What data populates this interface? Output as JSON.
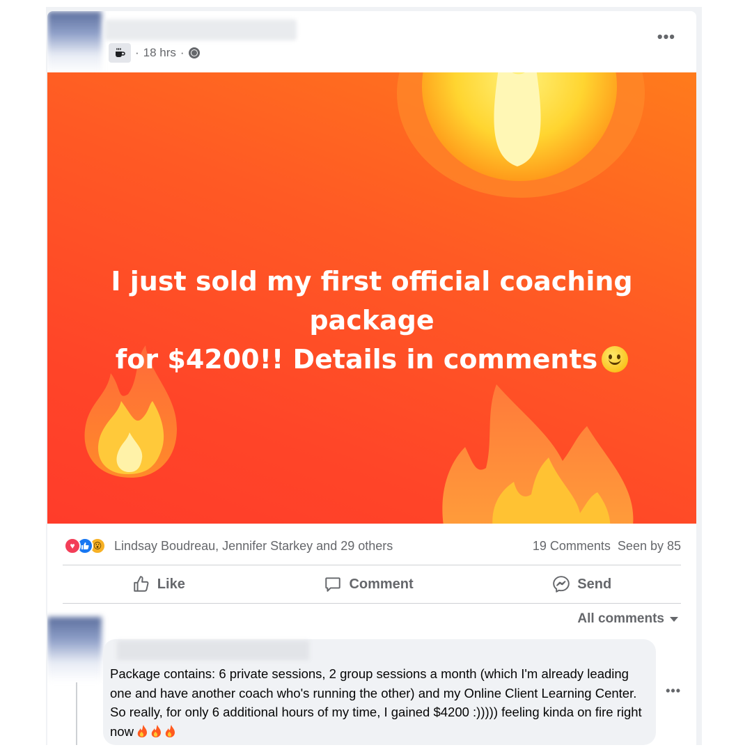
{
  "post": {
    "time": "18 hrs",
    "meta_separator": "·",
    "group_icon": "coffee-cup-icon",
    "audience_icon": "globe-icon",
    "more_icon": "more-horizontal-icon",
    "more_label": "•••"
  },
  "banner": {
    "line1": "I just sold my first official coaching package",
    "line2": "for $4200!! Details in comments",
    "emoji": "slightly-smiling-face-icon",
    "background_color": "#ff4f26"
  },
  "reactions": {
    "icons": [
      "love-reaction-icon",
      "like-reaction-icon",
      "wow-reaction-icon"
    ],
    "names": "Lindsay Boudreau, Jennifer Starkey and 29 others",
    "comments_count": "19 Comments",
    "seen_by": "Seen by 85"
  },
  "actions": {
    "like": "Like",
    "comment": "Comment",
    "send": "Send"
  },
  "comments": {
    "filter_label": "All comments",
    "first": {
      "text": "Package contains: 6 private sessions, 2 group sessions a month (which I'm already leading one and have another coach who's running the other) and my Online Client Learning Center. So really, for only 6 additional hours of my time, I gained $4200 :))))) feeling kinda on fire right now",
      "trailing_icons": [
        "fire-icon",
        "fire-icon",
        "fire-icon"
      ],
      "more_label": "•••"
    }
  },
  "colors": {
    "facebook_blue": "#1877f2",
    "text_secondary": "#65676b",
    "banner_orange": "#ff5a24"
  }
}
